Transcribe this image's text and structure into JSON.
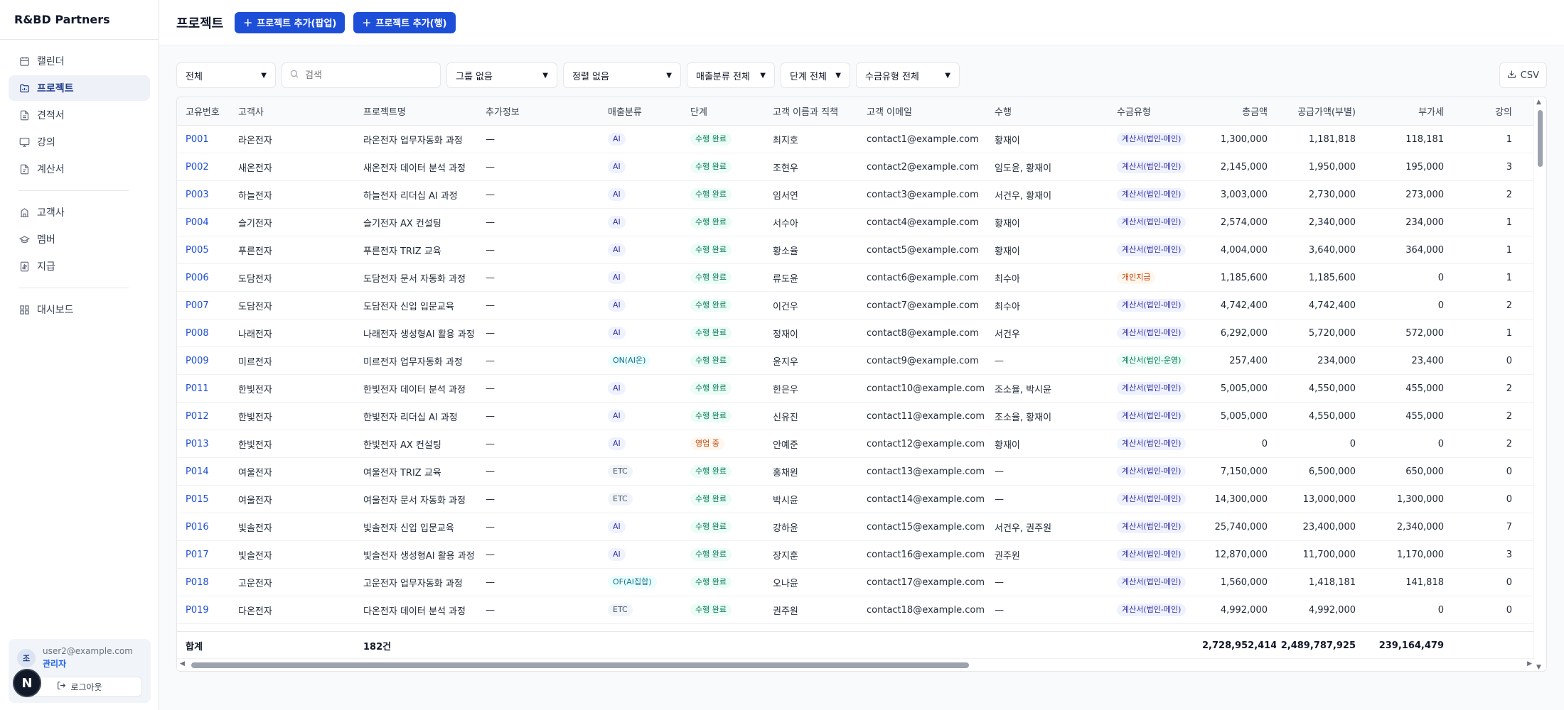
{
  "brand": "R&BD Partners",
  "nav": [
    {
      "label": "캘린더",
      "icon": "calendar-icon",
      "name": "sidebar-item-calendar"
    },
    {
      "label": "프로젝트",
      "icon": "folder-chart-icon",
      "name": "sidebar-item-projects",
      "active": true
    },
    {
      "label": "견적서",
      "icon": "document-icon",
      "name": "sidebar-item-quotes"
    },
    {
      "label": "강의",
      "icon": "presentation-icon",
      "name": "sidebar-item-lectures"
    },
    {
      "label": "계산서",
      "icon": "receipt-icon",
      "name": "sidebar-item-invoices"
    },
    {
      "label": "고객사",
      "icon": "building-icon",
      "name": "sidebar-item-clients"
    },
    {
      "label": "멤버",
      "icon": "graduation-cap-icon",
      "name": "sidebar-item-members"
    },
    {
      "label": "지급",
      "icon": "payment-icon",
      "name": "sidebar-item-payments"
    },
    {
      "label": "대시보드",
      "icon": "dashboard-icon",
      "name": "sidebar-item-dashboard"
    }
  ],
  "user": {
    "initial": "조",
    "email": "user2@example.com",
    "role": "관리자",
    "logout_label": "로그아웃"
  },
  "next_badge": "N",
  "header": {
    "title": "프로젝트",
    "add_popup_label": "프로젝트 추가(팝업)",
    "add_row_label": "프로젝트 추가(행)"
  },
  "filters": {
    "scope": "전체",
    "search_placeholder": "검색",
    "group": "그룹 없음",
    "sort": "정렬 없음",
    "revenue": "매출분류 전체",
    "stage": "단계 전체",
    "payment": "수금유형 전체",
    "csv_label": "CSV"
  },
  "columns": [
    "고유번호",
    "고객사",
    "프로젝트명",
    "추가정보",
    "매출분류",
    "단계",
    "고객 이름과 직책",
    "고객 이메일",
    "수행",
    "수금유형",
    "총금액",
    "공급가액(부별)",
    "부가세",
    "강의"
  ],
  "rows": [
    [
      "P001",
      "라온전자",
      "라온전자 업무자동화 과정",
      "—",
      "AI",
      "수행 완료",
      "최지호",
      "contact1@example.com",
      "황재이",
      "계산서(법인-메인)",
      "1,300,000",
      "1,181,818",
      "118,181",
      "1"
    ],
    [
      "P002",
      "새온전자",
      "새온전자 데이터 분석 과정",
      "—",
      "AI",
      "수행 완료",
      "조현우",
      "contact2@example.com",
      "임도윤, 황재이",
      "계산서(법인-메인)",
      "2,145,000",
      "1,950,000",
      "195,000",
      "3"
    ],
    [
      "P003",
      "하늘전자",
      "하늘전자 리더십 AI 과정",
      "—",
      "AI",
      "수행 완료",
      "임서연",
      "contact3@example.com",
      "서건우, 황재이",
      "계산서(법인-메인)",
      "3,003,000",
      "2,730,000",
      "273,000",
      "2"
    ],
    [
      "P004",
      "슬기전자",
      "슬기전자 AX 컨설팅",
      "—",
      "AI",
      "수행 완료",
      "서수아",
      "contact4@example.com",
      "황재이",
      "계산서(법인-메인)",
      "2,574,000",
      "2,340,000",
      "234,000",
      "1"
    ],
    [
      "P005",
      "푸른전자",
      "푸른전자 TRIZ 교육",
      "—",
      "AI",
      "수행 완료",
      "황소율",
      "contact5@example.com",
      "황재이",
      "계산서(법인-메인)",
      "4,004,000",
      "3,640,000",
      "364,000",
      "1"
    ],
    [
      "P006",
      "도담전자",
      "도담전자 문서 자동화 과정",
      "—",
      "AI",
      "수행 완료",
      "류도윤",
      "contact6@example.com",
      "최수아",
      "개인지급",
      "1,185,600",
      "1,185,600",
      "0",
      "1"
    ],
    [
      "P007",
      "도담전자",
      "도담전자 신입 입문교육",
      "—",
      "AI",
      "수행 완료",
      "이건우",
      "contact7@example.com",
      "최수아",
      "계산서(법인-메인)",
      "4,742,400",
      "4,742,400",
      "0",
      "2"
    ],
    [
      "P008",
      "나래전자",
      "나래전자 생성형AI 활용 과정",
      "—",
      "AI",
      "수행 완료",
      "정재이",
      "contact8@example.com",
      "서건우",
      "계산서(법인-메인)",
      "6,292,000",
      "5,720,000",
      "572,000",
      "1"
    ],
    [
      "P009",
      "미르전자",
      "미르전자 업무자동화 과정",
      "—",
      "ON(AI온)",
      "수행 완료",
      "윤지우",
      "contact9@example.com",
      "—",
      "계산서(법인-운영)",
      "257,400",
      "234,000",
      "23,400",
      "0"
    ],
    [
      "P011",
      "한빛전자",
      "한빛전자 데이터 분석 과정",
      "—",
      "AI",
      "수행 완료",
      "한은우",
      "contact10@example.com",
      "조소율, 박시윤",
      "계산서(법인-메인)",
      "5,005,000",
      "4,550,000",
      "455,000",
      "2"
    ],
    [
      "P012",
      "한빛전자",
      "한빛전자 리더십 AI 과정",
      "—",
      "AI",
      "수행 완료",
      "신유진",
      "contact11@example.com",
      "조소율, 황재이",
      "계산서(법인-메인)",
      "5,005,000",
      "4,550,000",
      "455,000",
      "2"
    ],
    [
      "P013",
      "한빛전자",
      "한빛전자 AX 컨설팅",
      "—",
      "AI",
      "영업 중",
      "안예준",
      "contact12@example.com",
      "황재이",
      "계산서(법인-메인)",
      "0",
      "0",
      "0",
      "2"
    ],
    [
      "P014",
      "여울전자",
      "여울전자 TRIZ 교육",
      "—",
      "ETC",
      "수행 완료",
      "홍채원",
      "contact13@example.com",
      "—",
      "계산서(법인-메인)",
      "7,150,000",
      "6,500,000",
      "650,000",
      "0"
    ],
    [
      "P015",
      "여울전자",
      "여울전자 문서 자동화 과정",
      "—",
      "ETC",
      "수행 완료",
      "박시윤",
      "contact14@example.com",
      "—",
      "계산서(법인-메인)",
      "14,300,000",
      "13,000,000",
      "1,300,000",
      "0"
    ],
    [
      "P016",
      "빛솔전자",
      "빛솔전자 신입 입문교육",
      "—",
      "AI",
      "수행 완료",
      "강하윤",
      "contact15@example.com",
      "서건우, 권주원",
      "계산서(법인-메인)",
      "25,740,000",
      "23,400,000",
      "2,340,000",
      "7"
    ],
    [
      "P017",
      "빛솔전자",
      "빛솔전자 생성형AI 활용 과정",
      "—",
      "AI",
      "수행 완료",
      "장지훈",
      "contact16@example.com",
      "권주원",
      "계산서(법인-메인)",
      "12,870,000",
      "11,700,000",
      "1,170,000",
      "3"
    ],
    [
      "P018",
      "고운전자",
      "고운전자 업무자동화 과정",
      "—",
      "OF(AI집합)",
      "수행 완료",
      "오나윤",
      "contact17@example.com",
      "—",
      "계산서(법인-메인)",
      "1,560,000",
      "1,418,181",
      "141,818",
      "0"
    ],
    [
      "P019",
      "다온전자",
      "다온전자 데이터 분석 과정",
      "—",
      "ETC",
      "수행 완료",
      "권주원",
      "contact18@example.com",
      "—",
      "계산서(법인-메인)",
      "4,992,000",
      "4,992,000",
      "0",
      "0"
    ]
  ],
  "footer": {
    "label": "합계",
    "count": "182건",
    "total": "2,728,952,414",
    "supply": "2,489,787,925",
    "vat": "239,164,479"
  }
}
